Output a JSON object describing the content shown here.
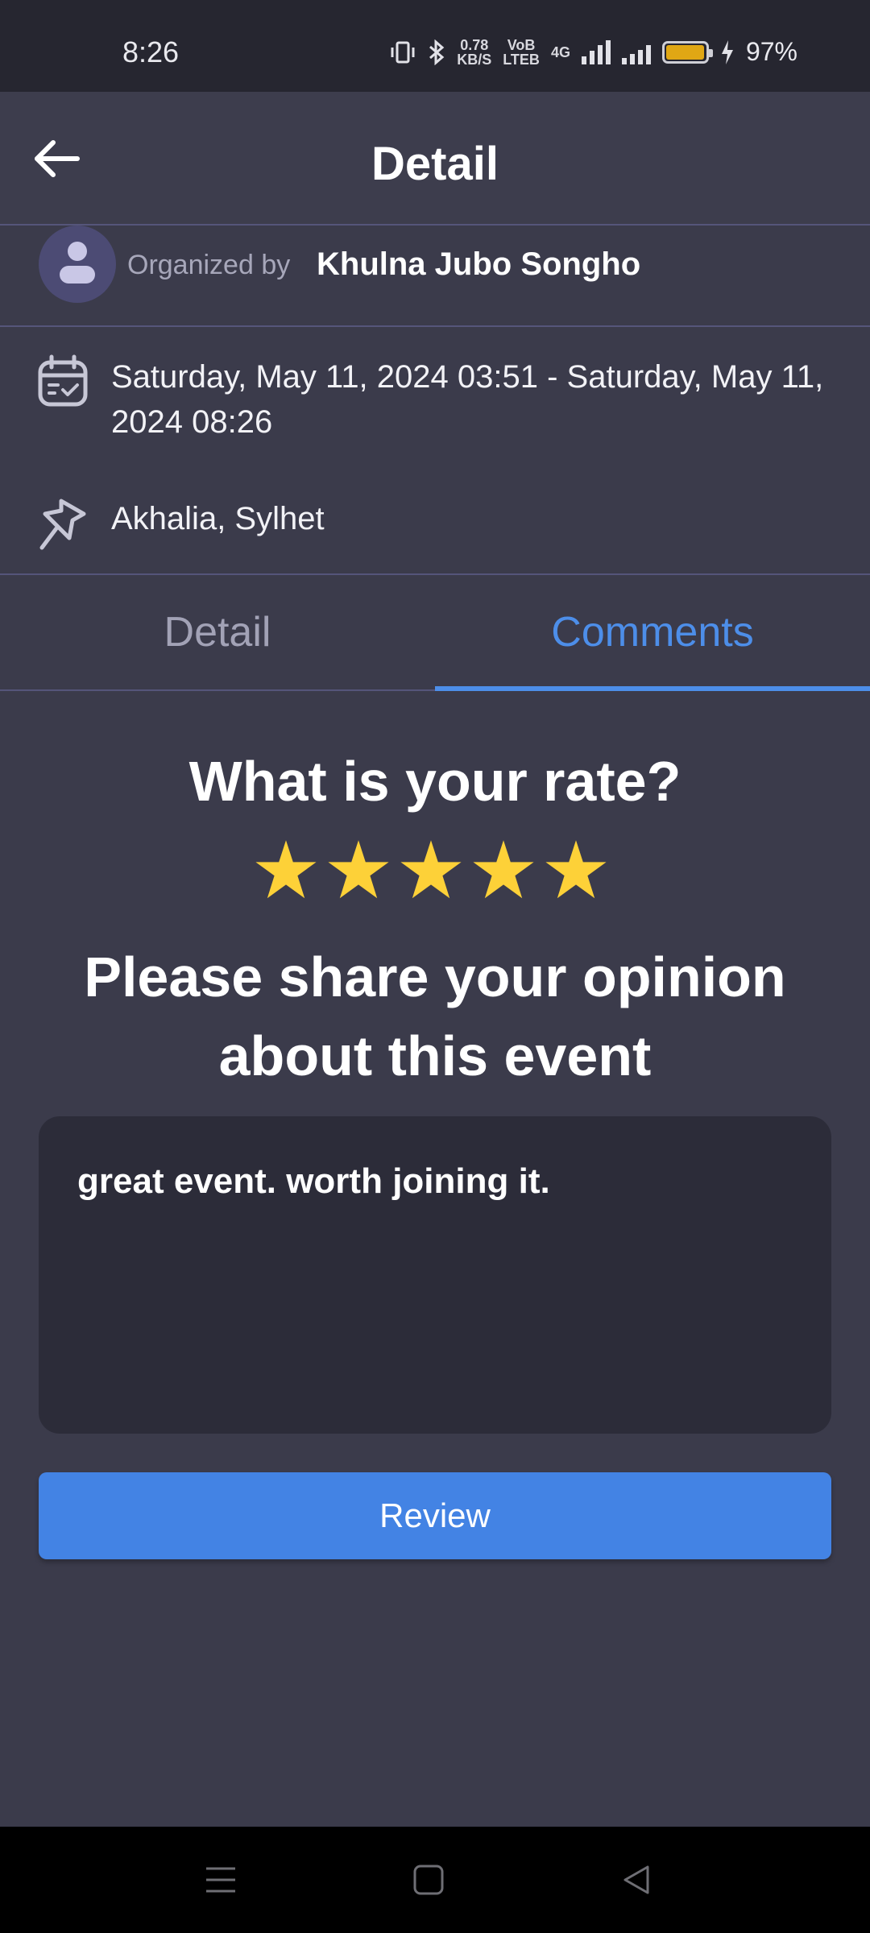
{
  "status_bar": {
    "time": "8:26",
    "net_speed_value": "0.78",
    "net_speed_unit": "KB/S",
    "volte_top": "VoB",
    "volte_bottom": "LTEB",
    "network_type": "4G",
    "battery_percent": "97%",
    "battery_level": 0.97,
    "battery_color": "#e0a714"
  },
  "app_bar": {
    "title": "Detail",
    "back_icon": "arrow-left-icon"
  },
  "event": {
    "organized_by_label": "Organized by",
    "organizer_name": "Khulna Jubo Songho",
    "date_range": "Saturday, May 11, 2024 03:51 - Saturday, May 11, 2024 08:26",
    "location": "Akhalia, Sylhet"
  },
  "tabs": [
    {
      "label": "Detail",
      "active": false
    },
    {
      "label": "Comments",
      "active": true
    }
  ],
  "review": {
    "rate_question": "What is your rate?",
    "rating": 5,
    "max_rating": 5,
    "star_color": "#fdd138",
    "opinion_prompt": "Please share your opinion about this event",
    "comment_text": "great event. worth joining it.",
    "submit_label": "Review"
  },
  "colors": {
    "background": "#3b3b4b",
    "accent": "#4d8ee9",
    "button": "#4383e4"
  },
  "nav_bar": {
    "icons": [
      "menu-icon",
      "home-square-icon",
      "back-triangle-icon"
    ]
  }
}
